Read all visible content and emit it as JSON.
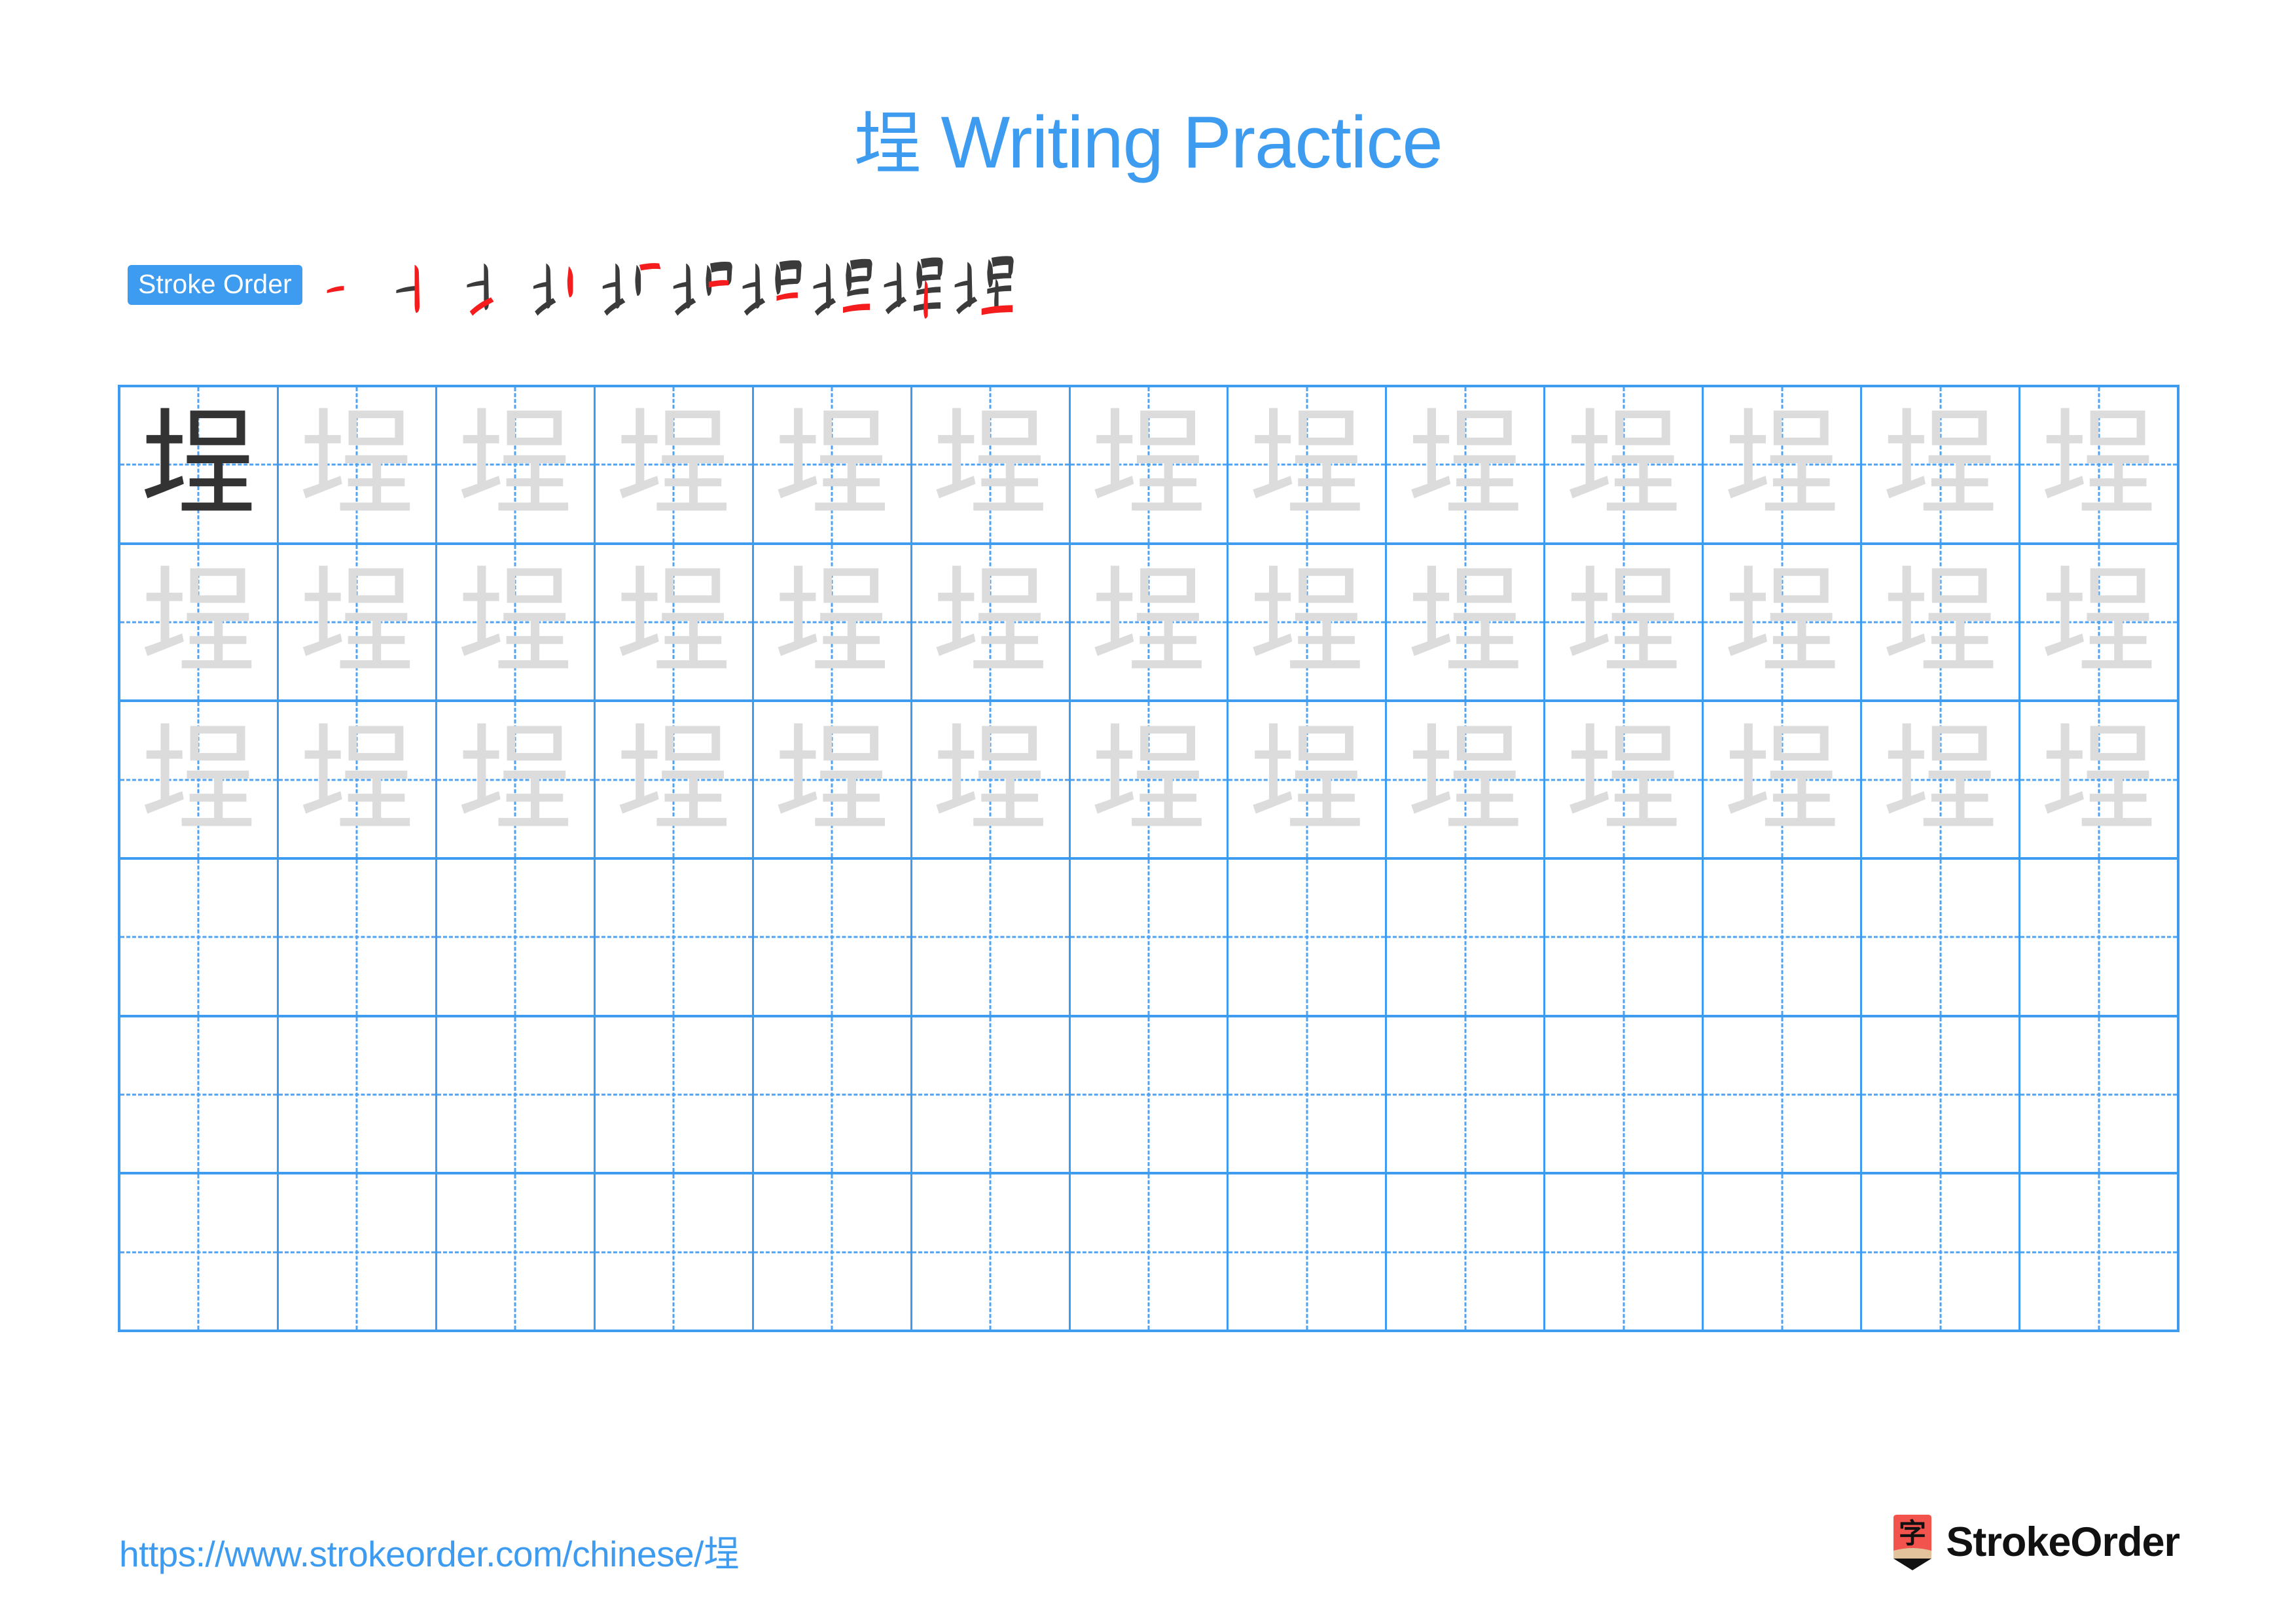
{
  "header": {
    "character": "埕",
    "title_suffix": " Writing Practice",
    "title_full": "埕 Writing Practice",
    "title_color": "#3d9bf0"
  },
  "stroke_order": {
    "badge_label": "Stroke Order",
    "badge_bg": "#3d9bf0",
    "badge_text_color": "#ffffff",
    "stroke_count": 10,
    "done_color": "#3b3b3b",
    "new_color": "#f41c1c",
    "steps": [
      {
        "index": 1,
        "partial": "一",
        "new_stroke": "heng"
      },
      {
        "index": 2,
        "partial": "十",
        "new_stroke": "shu"
      },
      {
        "index": 3,
        "partial": "士",
        "new_stroke": "heng"
      },
      {
        "index": 4,
        "partial": "扌",
        "new_stroke": "dian"
      },
      {
        "index": 5,
        "partial": "圠",
        "new_stroke": "shu"
      },
      {
        "index": 6,
        "partial": "圯",
        "new_stroke": "heng-zhe"
      },
      {
        "index": 7,
        "partial": "坥",
        "new_stroke": "heng"
      },
      {
        "index": 8,
        "partial": "坢",
        "new_stroke": "heng"
      },
      {
        "index": 9,
        "partial": "垾",
        "new_stroke": "shu"
      },
      {
        "index": 10,
        "partial": "埕",
        "new_stroke": "heng"
      }
    ]
  },
  "grid": {
    "columns": 13,
    "rows": 6,
    "border_color": "#3d9bf0",
    "guide_color": "#4fa3f2",
    "model_char_color": "#333333",
    "trace_char_color": "#dcdcdc",
    "row_modes": [
      "model-then-trace",
      "trace",
      "trace",
      "blank",
      "blank",
      "blank"
    ],
    "character": "埕"
  },
  "footer": {
    "url": "https://www.strokeorder.com/chinese/埕",
    "url_color": "#3d9bf0",
    "brand_name": "StrokeOrder",
    "brand_mark_char": "字",
    "brand_mark_bg": "#f2534d",
    "brand_mark_tip": "#e3c39b"
  }
}
